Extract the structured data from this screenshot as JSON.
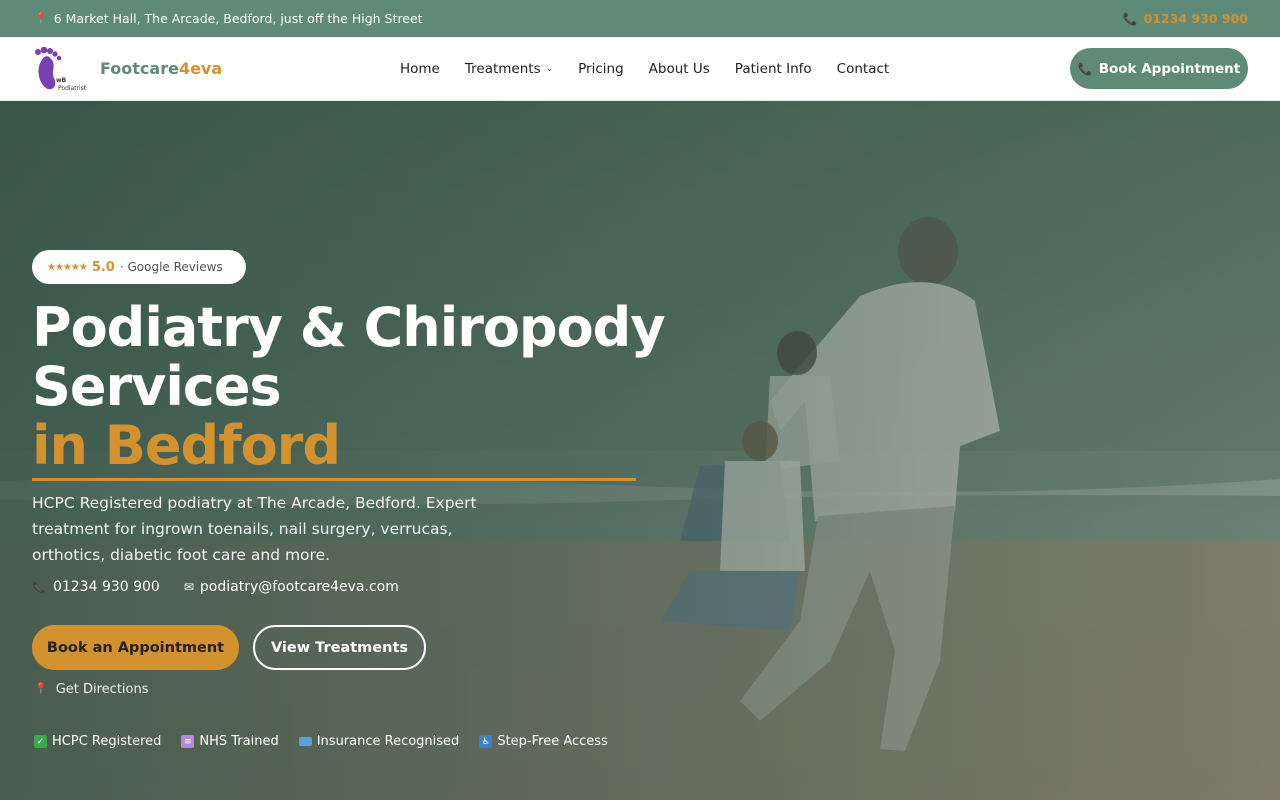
{
  "topbar": {
    "address": "6 Market Hall, The Arcade, Bedford, just off the High Street",
    "phone": "01234 930 900"
  },
  "header": {
    "brand_first": "Footcare",
    "brand_second": "4eva",
    "logo_tag": "Podiatrist",
    "nav": [
      "Home",
      "Treatments",
      "Pricing",
      "About Us",
      "Patient Info",
      "Contact"
    ],
    "book_label": "Book Appointment"
  },
  "hero": {
    "rating_stars": "★★★★★",
    "rating_score": "5.0",
    "rating_source": "· Google Reviews",
    "title_line1": "Podiatry & Chiropody",
    "title_line2": "Services",
    "title_line3": "in Bedford",
    "description": "HCPC Registered podiatry at The Arcade, Bedford. Expert treatment for ingrown toenails, nail surgery, verrucas, orthotics, diabetic foot care and more.",
    "phone": "01234 930 900",
    "email": "podiatry@footcare4eva.com",
    "primary_button": "Book an Appointment",
    "secondary_button": "View Treatments",
    "directions": "Get Directions",
    "badges": [
      "HCPC Registered",
      "NHS Trained",
      "Insurance Recognised",
      "Step-Free Access"
    ]
  },
  "colors": {
    "brand_green": "#5f8a78",
    "accent_gold": "#d4922e",
    "pin_red": "#e25b6a"
  },
  "icons": {
    "address": "map-pin-icon",
    "phone": "phone-icon",
    "email": "envelope-icon",
    "badge_hcpc": "check-square-icon",
    "badge_nhs": "scroll-icon",
    "badge_insurance": "card-icon",
    "badge_access": "wheelchair-icon"
  }
}
